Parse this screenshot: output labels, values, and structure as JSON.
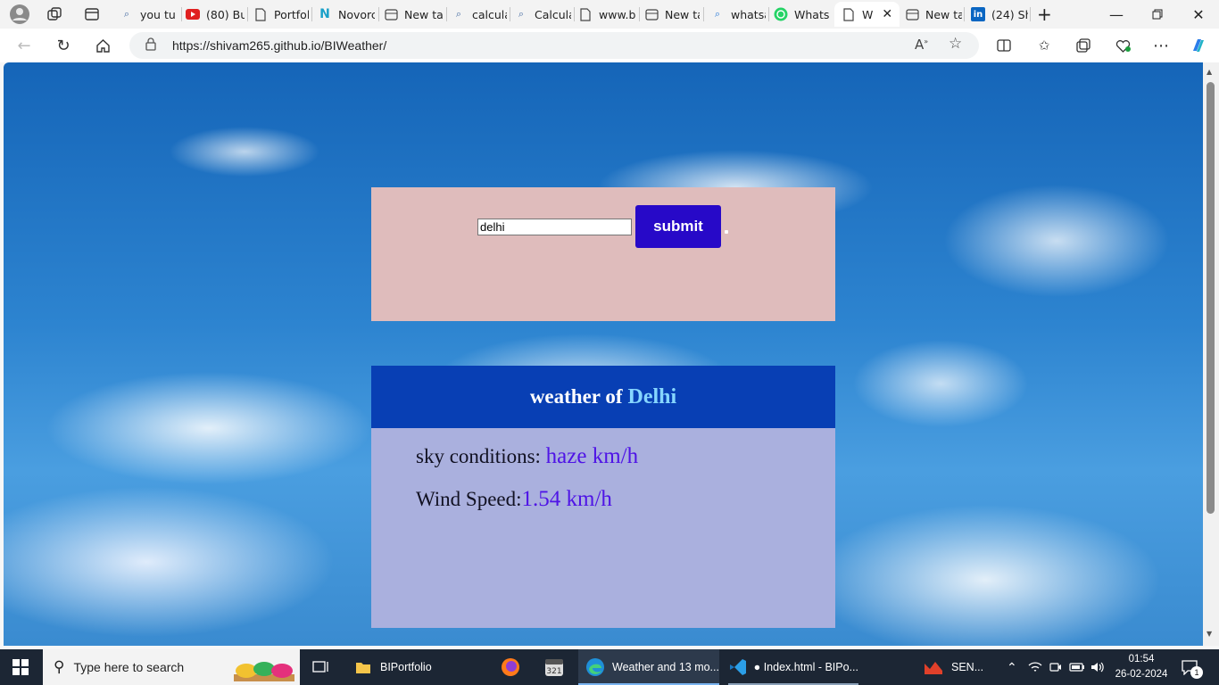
{
  "browser": {
    "tabs": [
      {
        "label": "you tu",
        "icon": "search-icon"
      },
      {
        "label": "(80) Bu",
        "icon": "youtube-icon"
      },
      {
        "label": "Portfol",
        "icon": "page-icon"
      },
      {
        "label": "Novorc",
        "icon": "novoresume-icon"
      },
      {
        "label": "New ta",
        "icon": "newtab-icon"
      },
      {
        "label": "calcula",
        "icon": "search-icon"
      },
      {
        "label": "Calcula",
        "icon": "search-icon"
      },
      {
        "label": "www.b",
        "icon": "page-icon"
      },
      {
        "label": "New ta",
        "icon": "newtab-icon"
      },
      {
        "label": "whatsa",
        "icon": "search-icon"
      },
      {
        "label": "Whats",
        "icon": "whatsapp-icon"
      },
      {
        "label": "W",
        "icon": "page-icon",
        "active": true
      },
      {
        "label": "New ta",
        "icon": "newtab-icon"
      },
      {
        "label": "(24) Sh",
        "icon": "linkedin-icon"
      }
    ],
    "url": "https://shivam265.github.io/BIWeather/"
  },
  "page": {
    "city_input_value": "delhi",
    "submit_label": "submit",
    "heading_prefix": "weather of",
    "heading_city": "Delhi",
    "sky_label": "sky conditions:",
    "sky_value": "haze km/h",
    "wind_label": "Wind Speed:",
    "wind_value": "1.54 km/h"
  },
  "taskbar": {
    "search_placeholder": "Type here to search",
    "apps": [
      {
        "label": "BIPortfolio",
        "icon": "folder-icon"
      },
      {
        "label": "Weather and 13 mo...",
        "icon": "edge-icon"
      },
      {
        "label": "● Index.html - BIPo...",
        "icon": "vscode-icon"
      },
      {
        "label": "SEN...",
        "icon": "sensex-icon"
      }
    ],
    "time": "01:54",
    "date": "26-02-2024",
    "notification_count": "1"
  },
  "colors": {
    "form_bg": "#dfbcbc",
    "submit_bg": "#2709c8",
    "result_head_bg": "#083fb4",
    "result_bg": "#aab0de",
    "value_color": "#4f14e6",
    "city_color": "#86d6ff"
  }
}
